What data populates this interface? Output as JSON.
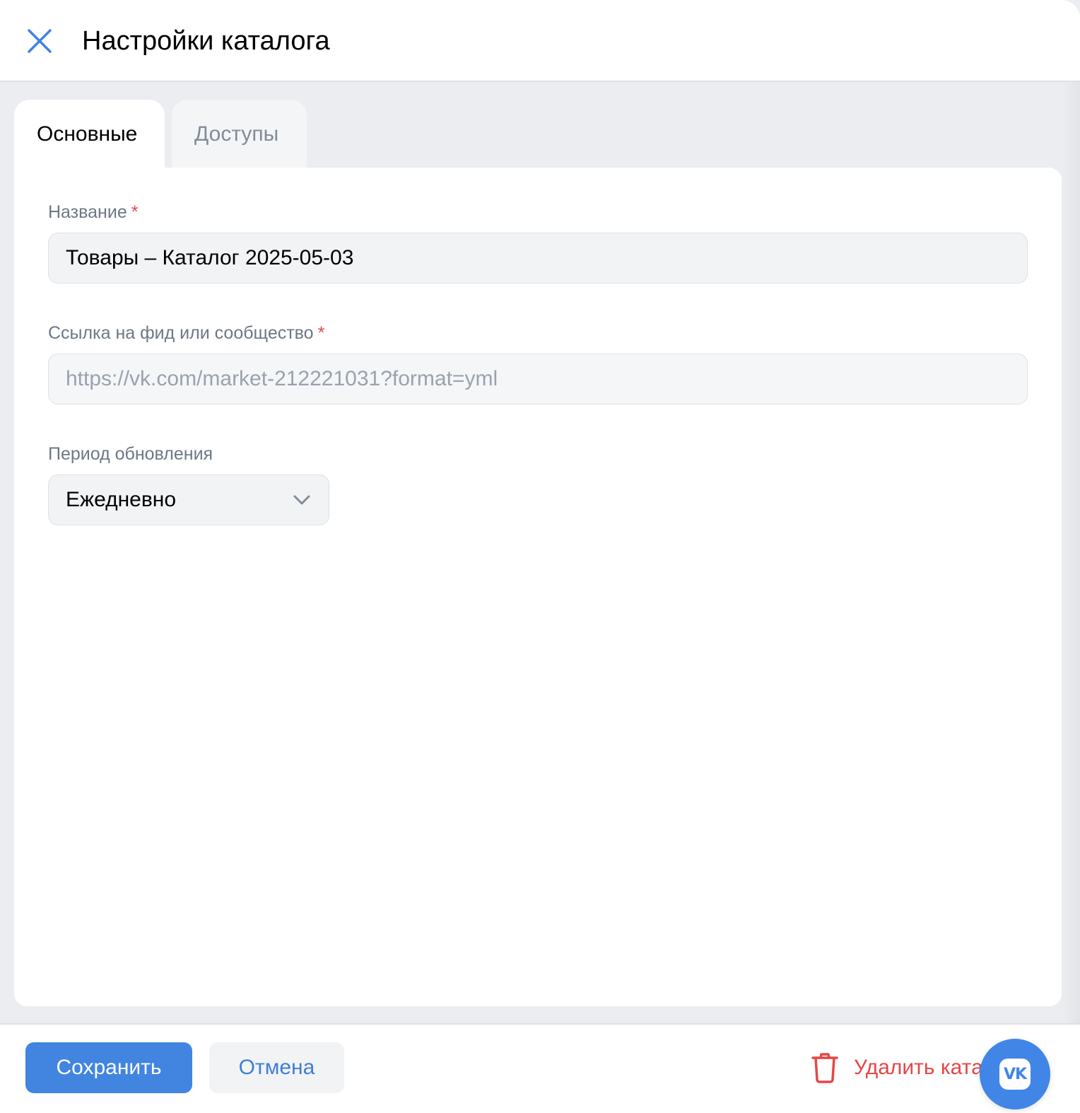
{
  "header": {
    "title": "Настройки каталога",
    "close_icon": "close-icon"
  },
  "tabs": [
    {
      "label": "Основные",
      "active": true
    },
    {
      "label": "Доступы",
      "active": false
    }
  ],
  "form": {
    "name": {
      "label": "Название",
      "required_mark": "*",
      "value": "Товары – Каталог 2025-05-03"
    },
    "feed_link": {
      "label": "Ссылка на фид или сообщество",
      "required_mark": "*",
      "value": "https://vk.com/market-212221031?format=yml"
    },
    "update_period": {
      "label": "Период обновления",
      "value": "Ежедневно",
      "icon": "chevron-down-icon"
    }
  },
  "footer": {
    "save_label": "Сохранить",
    "cancel_label": "Отмена",
    "delete_label": "Удалить каталог",
    "delete_icon": "trash-icon"
  },
  "fab": {
    "logo_text": "VK"
  },
  "colors": {
    "accent": "#4185e0",
    "danger": "#e64646",
    "background": "#ebedf0"
  }
}
